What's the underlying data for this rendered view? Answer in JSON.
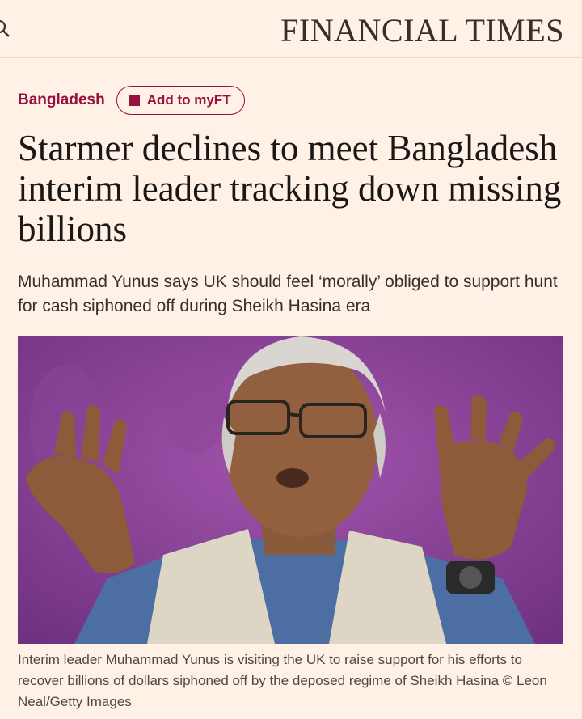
{
  "header": {
    "brand": "FINANCIAL TIMES",
    "search_icon": "search-icon"
  },
  "article": {
    "topic": "Bangladesh",
    "myft_button": "Add to myFT",
    "headline": "Starmer declines to meet Bangladesh interim leader tracking down missing billions",
    "standfirst": "Muhammad Yunus says UK should feel ‘morally’ obliged to support hunt for cash siphoned off during Sheikh Hasina era",
    "caption": "Interim leader Muhammad Yunus is visiting the UK to raise support for his efforts to recover billions of dollars siphoned off by the deposed regime of Sheikh Hasina © Leon Neal/Getty Images"
  },
  "colors": {
    "background": "#fff1e5",
    "accent": "#990f3d",
    "photo_backdrop": "#7b3a88"
  }
}
